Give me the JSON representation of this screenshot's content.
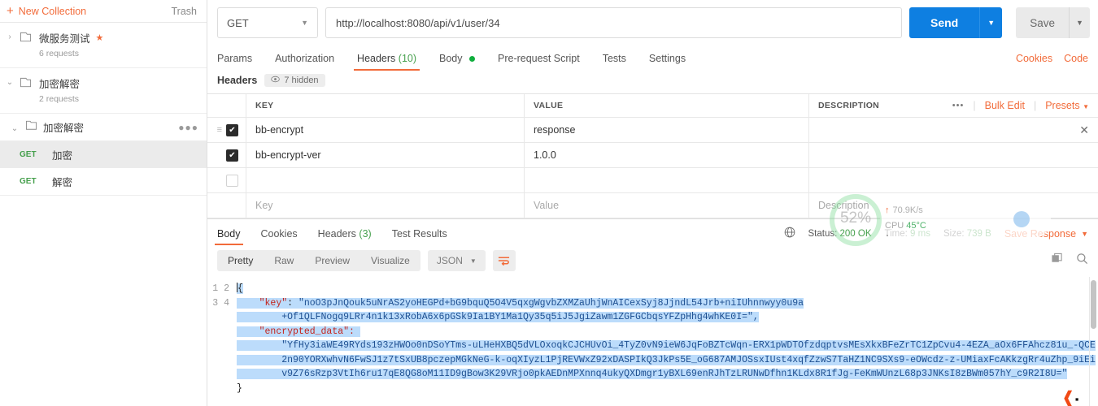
{
  "sidebar": {
    "new_collection": "New Collection",
    "new_collection_plus": "+",
    "trash": "Trash",
    "collections": [
      {
        "name": "微服务测试",
        "requests": "6 requests",
        "starred": true,
        "caret": "›"
      },
      {
        "name": "加密解密",
        "requests": "2 requests",
        "starred": false,
        "caret": "⌄"
      }
    ],
    "folder": {
      "caret": "⌄",
      "name": "加密解密",
      "menu": "●●●"
    },
    "requests": [
      {
        "method": "GET",
        "name": "加密",
        "selected": true
      },
      {
        "method": "GET",
        "name": "解密",
        "selected": false
      }
    ]
  },
  "request": {
    "method": "GET",
    "method_caret": "▼",
    "url": "http://localhost:8080/api/v1/user/34",
    "send_label": "Send",
    "send_caret": "▼",
    "save_label": "Save",
    "save_caret": "▼",
    "tabs": [
      {
        "label": "Params",
        "active": false
      },
      {
        "label": "Authorization",
        "active": false
      },
      {
        "label": "Headers",
        "count": "(10)",
        "active": true
      },
      {
        "label": "Body",
        "dot": true,
        "active": false
      },
      {
        "label": "Pre-request Script",
        "active": false
      },
      {
        "label": "Tests",
        "active": false
      },
      {
        "label": "Settings",
        "active": false
      }
    ],
    "cookies_link": "Cookies",
    "code_link": "Code"
  },
  "headers_panel": {
    "title": "Headers",
    "hidden_label": "7 hidden",
    "eye_icon": "👁",
    "columns": {
      "key": "KEY",
      "value": "VALUE",
      "description": "DESCRIPTION"
    },
    "tools": {
      "dots": "•••",
      "bulk_edit": "Bulk Edit",
      "presets": "Presets",
      "presets_caret": "▼"
    },
    "rows": [
      {
        "checked": true,
        "key": "bb-encrypt",
        "value": "response",
        "description": "",
        "has_close": true,
        "close": "✕",
        "grip": "≡"
      },
      {
        "checked": true,
        "key": "bb-encrypt-ver",
        "value": "1.0.0",
        "description": "",
        "has_close": false
      },
      {
        "checked": false,
        "key": "",
        "value": "",
        "description": ""
      }
    ],
    "placeholder_row": {
      "key": "Key",
      "value": "Value",
      "description": "Description"
    }
  },
  "response": {
    "tabs": [
      {
        "label": "Body",
        "active": true
      },
      {
        "label": "Cookies",
        "active": false
      },
      {
        "label": "Headers",
        "count": "(3)",
        "active": false
      },
      {
        "label": "Test Results",
        "active": false
      }
    ],
    "status_label": "Status:",
    "status_value": "200 OK",
    "time_label": "Time:",
    "time_value": "9 ms",
    "size_label": "Size:",
    "size_value": "739 B",
    "save_response": "Save Response",
    "save_response_caret": "▼",
    "globe_icon": "⊕",
    "view_modes": [
      {
        "label": "Pretty",
        "active": true
      },
      {
        "label": "Raw",
        "active": false
      },
      {
        "label": "Preview",
        "active": false
      },
      {
        "label": "Visualize",
        "active": false
      }
    ],
    "format": "JSON",
    "format_caret": "▼",
    "wrap_icon": "⇶",
    "copy_icon": "❐",
    "search_icon": "🔍"
  },
  "code": {
    "line_numbers": [
      "1",
      "2",
      "3",
      "4"
    ],
    "open_brace": "{",
    "close_brace": "}",
    "key_field_name": "\"key\"",
    "key_value_part1": "\"noO3pJnQouk5uNrAS2yoHEGPd+bG9bquQ5O4V5qxgWgvbZXMZaUhjWnAICexSyj8JjndL54Jrb+niIUhnnwyy0u9a",
    "key_value_part2": "+Of1QLFNogq9LRr4n1k13xRobA6x6pGSk9Ia1BY1Ma1Qy35q5iJ5JgiZawm1ZGFGCbqsYFZpHhg4whKE0I=\",",
    "encrypted_field_name": "\"encrypted_data\":",
    "encrypted_line1": "\"YfHy3iaWE49RYds193zHWOo0nDSoYTms-uLHeHXBQ5dVLOxoqkCJCHUvOi_4TyZ0vN9ieW6JqFoBZTcWqn-ERX1pWDTOfzdqptvsMEsXkxBFeZrTC1ZpCvu4-4EZA_aOx6FFAhcz81u_-QCE",
    "encrypted_line2": "2n90YORXwhvN6FwSJ1z7tSxUB8pczepMGkNeG-k-oqXIyzL1PjREVWxZ92xDASPIkQ3JkPs5E_oG687AMJOSsxIUst4xqfZzwS7TaHZ1NC9SXs9-eOWcdz-z-UMiaxFcAKkzgRr4uZhp_9iEi",
    "encrypted_line3": "v9Z76sRzp3VtIh6ru17qE8QG8oM11ID9gBow3K29VRjo0pkAEDnMPXnnq4ukyQXDmgr1yBXL69enRJhTzLRUNwDfhn1KLdx8R1fJg-FeKmWUnzL68p3JNKsI8zBWm057hY_c9R2I8U=\""
  },
  "overlay": {
    "percent": "52%",
    "net_up": "↑",
    "net_speed": "70.9K/s",
    "cpu_label": "CPU",
    "cpu_temp": "45°C"
  },
  "colors": {
    "accent": "#f26b3a",
    "send_blue": "#0e7fe1",
    "green": "#46a04d",
    "json_string": "#1d4f91",
    "json_key": "#c4241c",
    "selection": "#bcdcfb"
  }
}
